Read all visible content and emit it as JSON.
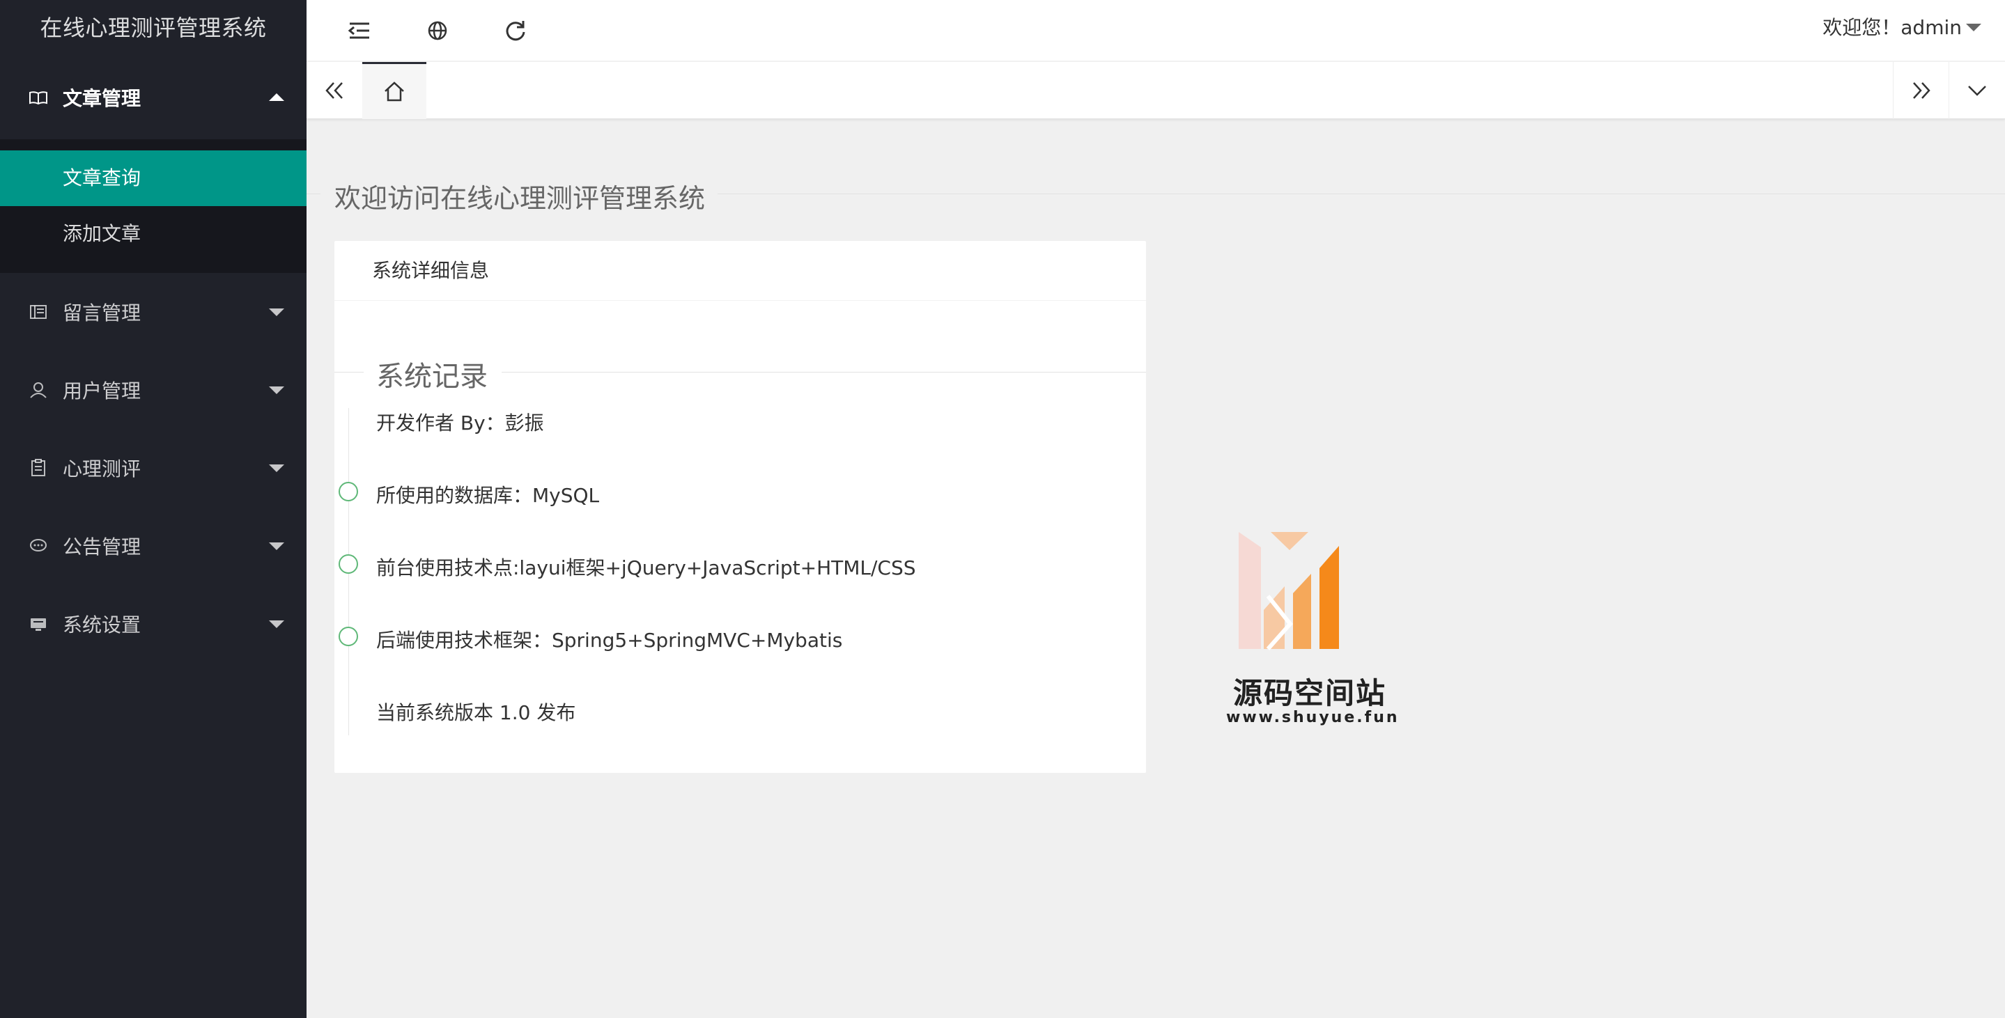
{
  "app": {
    "title": "在线心理测评管理系统"
  },
  "sidebar": {
    "groups": [
      {
        "label": "文章管理",
        "icon": "book-icon",
        "expanded": true,
        "items": [
          {
            "label": "文章查询",
            "active": true
          },
          {
            "label": "添加文章",
            "active": false
          }
        ]
      },
      {
        "label": "留言管理",
        "icon": "table-icon",
        "expanded": false
      },
      {
        "label": "用户管理",
        "icon": "user-icon",
        "expanded": false
      },
      {
        "label": "心理测评",
        "icon": "clipboard-icon",
        "expanded": false
      },
      {
        "label": "公告管理",
        "icon": "chat-icon",
        "expanded": false
      },
      {
        "label": "系统设置",
        "icon": "monitor-icon",
        "expanded": false
      }
    ]
  },
  "header": {
    "icons": [
      "menu-fold-icon",
      "globe-icon",
      "refresh-icon"
    ],
    "user_greeting": "欢迎您！admin"
  },
  "tabs": {
    "home_icon": "home-icon"
  },
  "main": {
    "welcome": "欢迎访问在线心理测评管理系统",
    "card": {
      "title": "系统详细信息",
      "section": "系统记录",
      "timeline": [
        "开发作者 By：彭振",
        "所使用的数据库：MySQL",
        "前台使用技术点:layui框架+jQuery+JavaScript+HTML/CSS",
        "后端使用技术框架：Spring5+SpringMVC+Mybatis",
        "当前系统版本 1.0 发布"
      ]
    },
    "watermark": {
      "title": "源码空间站",
      "url": "www.shuyue.fun"
    }
  },
  "colors": {
    "sidebar_bg": "#20222a",
    "accent": "#009688",
    "timeline_dot": "#5FB878",
    "watermark_orange": "#f5891a"
  }
}
